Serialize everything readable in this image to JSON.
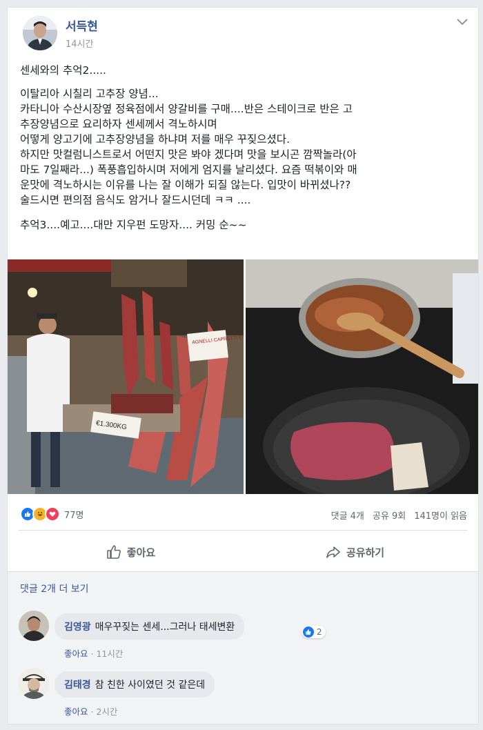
{
  "post": {
    "author": "서득현",
    "time": "14시간",
    "text_lines": {
      "p1": "센세와의 추억2.....",
      "p2_l1": "이탈리아 시칠리 고추장 양념...",
      "p2_l2": "카타니아 수산시장옆 정육점에서 양갈비를 구매....반은 스테이크로 반은 고",
      "p2_l3": "추장양념으로 요리하자 센세께서 격노하시며",
      "p2_l4": "어떻게 양고기에 고추장양념을 하냐며 저를 매우 꾸짖으셨다.",
      "p2_l5": "하지만 맛컬럼니스트로서 어떤지 맛은 봐야 겠다며 맛을 보시곤 깜짝놀라(아",
      "p2_l6": "마도 7일째라...) 폭풍흡입하시며 저에게 엄지를 날리셨다. 요즘 떡볶이와 매",
      "p2_l7": "운맛에 격노하시는 이유를 나는 잘 이해가 되질 않는다. 입맛이 바뀌셨나??",
      "p2_l8": "술드시면 편의점 음식도 암거나 잘드시던데 ㅋㅋ ....",
      "p3": "추억3....예고....대만 지우펀 도망자.... 커밍 순~~"
    },
    "photo1_sign1": "AGNELLI CAPRETTI €7.00/KG",
    "photo1_sign2": "€1.300KG",
    "reactions_count": "77명",
    "comments_count": "댓글 4개",
    "shares_count": "공유 9회",
    "seen_count": "141명이 읽음",
    "like_label": "좋아요",
    "share_label": "공유하기"
  },
  "comments": {
    "more": "댓글 2개 더 보기",
    "items": [
      {
        "name": "김영광",
        "text": "매우꾸짖는 센세...그러나 태세변환",
        "likes": "2",
        "like_label": "좋아요",
        "time": "11시간"
      },
      {
        "name": "김태경",
        "text": "참 친한 사이였던 것 같은데",
        "like_label": "좋아요",
        "time": "2시간"
      }
    ]
  },
  "colors": {
    "link": "#385898",
    "like_blue": "#1877f2",
    "haha_yellow": "#f7b125",
    "love_red": "#f33e58"
  }
}
